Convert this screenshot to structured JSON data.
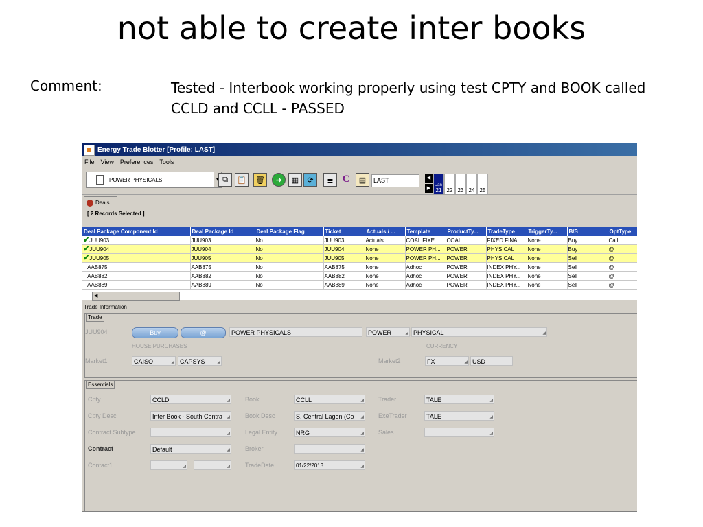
{
  "slide": {
    "title": "not able to create inter books",
    "comment_label": "Comment:",
    "comment_text": "Tested - Interbook working properly using test CPTY and BOOK called CCLD and CCLL - PASSED"
  },
  "window": {
    "title": "Energy Trade Blotter [Profile: LAST]",
    "menu": [
      "File",
      "View",
      "Preferences",
      "Tools"
    ],
    "toolbar": {
      "product_dropdown": "POWER PHYSICALS",
      "profile_value": "LAST",
      "date_month": "Jan",
      "dates": [
        "21",
        "22",
        "23",
        "24",
        "25"
      ]
    },
    "tab_label": "Deals",
    "records_selected": "[ 2 Records Selected ]",
    "columns": [
      "Deal Package Component Id",
      "Deal Package Id",
      "Deal Package Flag",
      "Ticket",
      "Actuals / ...",
      "Template",
      "ProductTy...",
      "TradeType",
      "TriggerTy...",
      "B/S",
      "OptType"
    ],
    "rows": [
      {
        "check": true,
        "hl": false,
        "cells": [
          "JUU903",
          "JUU903",
          "No",
          "JUU903",
          "Actuals",
          "COAL FIXE...",
          "COAL",
          "FIXED FINA...",
          "None",
          "Buy",
          "Call"
        ]
      },
      {
        "check": true,
        "hl": true,
        "cells": [
          "JUU904",
          "JUU904",
          "No",
          "JUU904",
          "None",
          "POWER PH...",
          "POWER",
          "PHYSICAL",
          "None",
          "Buy",
          "@"
        ]
      },
      {
        "check": true,
        "hl": true,
        "cells": [
          "JUU905",
          "JUU905",
          "No",
          "JUU905",
          "None",
          "POWER PH...",
          "POWER",
          "PHYSICAL",
          "None",
          "Sell",
          "@"
        ]
      },
      {
        "check": false,
        "hl": false,
        "cells": [
          "AAB875",
          "AAB875",
          "No",
          "AAB875",
          "None",
          "Adhoc",
          "POWER",
          "INDEX PHY...",
          "None",
          "Sell",
          "@"
        ]
      },
      {
        "check": false,
        "hl": false,
        "cells": [
          "AAB882",
          "AAB882",
          "No",
          "AAB882",
          "None",
          "Adhoc",
          "POWER",
          "INDEX PHY...",
          "None",
          "Sell",
          "@"
        ]
      },
      {
        "check": false,
        "hl": false,
        "cells": [
          "AAB889",
          "AAB889",
          "No",
          "AAB889",
          "None",
          "Adhoc",
          "POWER",
          "INDEX PHY...",
          "None",
          "Sell",
          "@"
        ]
      }
    ],
    "trade_info": {
      "section_label": "Trade Information",
      "trade_tab": "Trade",
      "deal_id": "JUU904",
      "buy_label": "Buy",
      "at_label": "@",
      "product": "POWER PHYSICALS",
      "commodity": "POWER",
      "trade_type": "PHYSICAL",
      "house_purchases": "HOUSE PURCHASES",
      "currency_label": "CURRENCY",
      "market1_label": "Market1",
      "market1_a": "CAISO",
      "market1_b": "CAPSYS",
      "market2_label": "Market2",
      "market2_a": "FX",
      "market2_b": "USD",
      "essentials_tab": "Essentials",
      "cpty_label": "Cpty",
      "cpty": "CCLD",
      "cpty_desc_label": "Cpty Desc",
      "cpty_desc": "Inter Book - South Centra",
      "contract_subtype_label": "Contract Subtype",
      "contract_label": "Contract",
      "contract": "Default",
      "contact1_label": "Contact1",
      "book_label": "Book",
      "book": "CCLL",
      "book_desc_label": "Book Desc",
      "book_desc": "S. Central Lagen (Co",
      "legal_entity_label": "Legal Entity",
      "legal_entity": "NRG",
      "broker_label": "Broker",
      "trade_date_label": "TradeDate",
      "trade_date": "01/22/2013",
      "trader_label": "Trader",
      "trader": "TALE",
      "exe_trader_label": "ExeTrader",
      "exe_trader": "TALE",
      "sales_label": "Sales"
    }
  }
}
